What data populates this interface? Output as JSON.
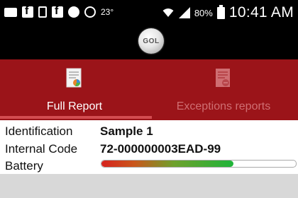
{
  "status_bar": {
    "temperature": "23°",
    "battery_percent": "80%",
    "time": "10:41 AM",
    "icons": [
      "message-icon",
      "facebook-icon",
      "document-icon",
      "facebook-icon",
      "cbm-app-icon",
      "whatsapp-icon",
      "wifi-icon",
      "signal-icon",
      "battery-icon"
    ]
  },
  "app": {
    "logo_text": "GOL"
  },
  "tabs": [
    {
      "label": "Full Report",
      "icon": "report-chart-icon",
      "selected": true
    },
    {
      "label": "Exceptions reports",
      "icon": "report-minus-icon",
      "selected": false
    }
  ],
  "details": {
    "identification_label": "Identification",
    "identification_value": "Sample 1",
    "internal_code_label": "Internal Code",
    "internal_code_value": "72-000000003EAD-99",
    "battery_label": "Battery",
    "battery_level": 0.68
  },
  "colors": {
    "accent": "#9b1419",
    "tab_inactive_text": "#cf6e72",
    "battery_low": "#d6231e",
    "battery_high": "#1fb53a"
  }
}
